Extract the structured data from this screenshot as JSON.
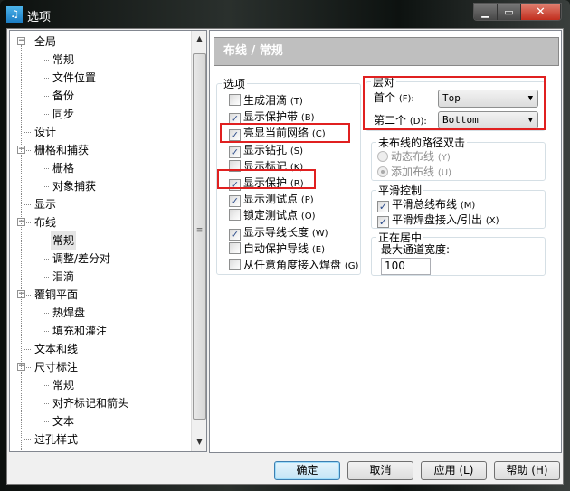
{
  "window": {
    "title": "选项",
    "icon": "app-logo-icon",
    "minimize": "minimize-icon",
    "maximize": "maximize-icon",
    "close": "close-icon"
  },
  "tree": {
    "items": [
      {
        "label": "全局",
        "level": 0,
        "expanded": true
      },
      {
        "label": "常规",
        "level": 1
      },
      {
        "label": "文件位置",
        "level": 1
      },
      {
        "label": "备份",
        "level": 1
      },
      {
        "label": "同步",
        "level": 1
      },
      {
        "label": "设计",
        "level": 0
      },
      {
        "label": "栅格和捕获",
        "level": 0,
        "expanded": true
      },
      {
        "label": "栅格",
        "level": 1
      },
      {
        "label": "对象捕获",
        "level": 1
      },
      {
        "label": "显示",
        "level": 0
      },
      {
        "label": "布线",
        "level": 0,
        "expanded": true
      },
      {
        "label": "常规",
        "level": 1,
        "selected": true
      },
      {
        "label": "调整/差分对",
        "level": 1
      },
      {
        "label": "泪滴",
        "level": 1
      },
      {
        "label": "覆铜平面",
        "level": 0,
        "expanded": true
      },
      {
        "label": "热焊盘",
        "level": 1
      },
      {
        "label": "填充和灌注",
        "level": 1
      },
      {
        "label": "文本和线",
        "level": 0
      },
      {
        "label": "尺寸标注",
        "level": 0,
        "expanded": true
      },
      {
        "label": "常规",
        "level": 1
      },
      {
        "label": "对齐标记和箭头",
        "level": 1
      },
      {
        "label": "文本",
        "level": 1
      },
      {
        "label": "过孔样式",
        "level": 0
      }
    ]
  },
  "panel": {
    "header": "布线 / 常规",
    "options": {
      "title": "选项",
      "items": [
        {
          "label": "生成泪滴",
          "key": "(T)",
          "checked": false
        },
        {
          "label": "显示保护带",
          "key": "(B)",
          "checked": true
        },
        {
          "label": "亮显当前网络",
          "key": "(C)",
          "checked": true,
          "highlighted": true
        },
        {
          "label": "显示钻孔",
          "key": "(S)",
          "checked": true
        },
        {
          "label": "显示标记",
          "key": "(K)",
          "checked": false
        },
        {
          "label": "显示保护",
          "key": "(R)",
          "checked": true,
          "highlighted": true
        },
        {
          "label": "显示测试点",
          "key": "(P)",
          "checked": true
        },
        {
          "label": "锁定测试点",
          "key": "(O)",
          "checked": false
        },
        {
          "label": "显示导线长度",
          "key": "(W)",
          "checked": true
        },
        {
          "label": "自动保护导线",
          "key": "(E)",
          "checked": false
        },
        {
          "label": "从任意角度接入焊盘",
          "key": "(G)",
          "checked": false
        }
      ]
    },
    "layer_pair": {
      "title": "层对",
      "first_label": "首个",
      "first_key": "(F):",
      "first_value": "Top",
      "second_label": "第二个",
      "second_key": "(D):",
      "second_value": "Bottom",
      "highlighted": true
    },
    "unrouted": {
      "title": "未布线的路径双击",
      "options": [
        {
          "label": "动态布线",
          "key": "(Y)",
          "selected": false
        },
        {
          "label": "添加布线",
          "key": "(U)",
          "selected": true
        }
      ],
      "disabled": true
    },
    "smoothing": {
      "title": "平滑控制",
      "items": [
        {
          "label": "平滑总线布线",
          "key": "(M)",
          "checked": true
        },
        {
          "label": "平滑焊盘接入/引出",
          "key": "(X)",
          "checked": true
        }
      ]
    },
    "centering": {
      "title": "正在居中",
      "width_label": "最大通道宽度:",
      "width_value": "100"
    }
  },
  "buttons": {
    "ok": "确定",
    "cancel": "取消",
    "apply": "应用 (L)",
    "help": "帮助 (H)"
  },
  "colors": {
    "highlight_box": "#e02020",
    "header_bg": "#bfbfbf"
  }
}
